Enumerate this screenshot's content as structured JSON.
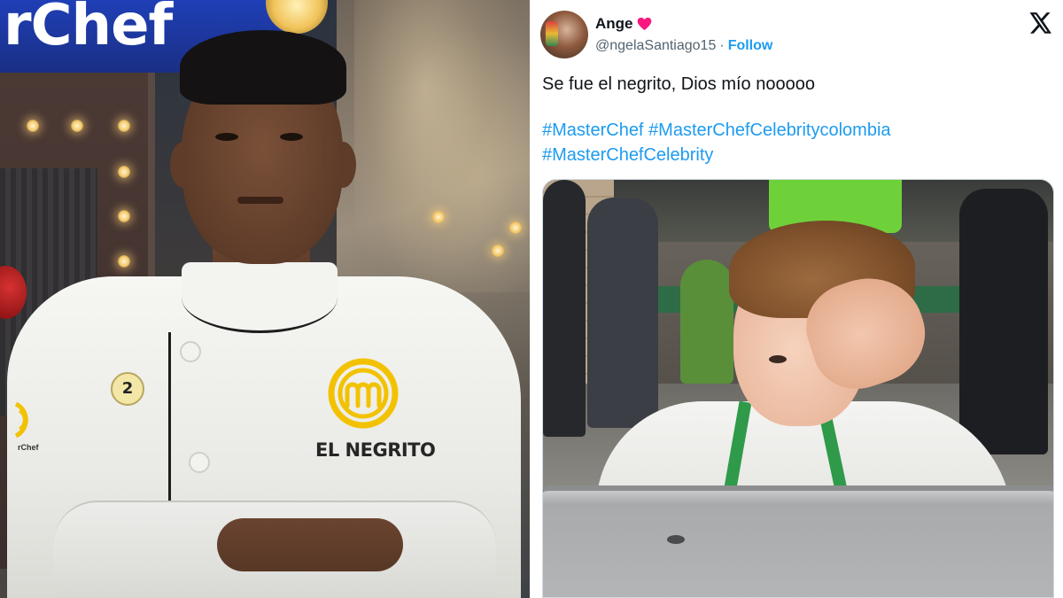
{
  "left_photo": {
    "sign_text": "rChef",
    "badge_number": "2",
    "name_tag": "EL NEGRITO",
    "sleeve_text": "rChef"
  },
  "tweet": {
    "display_name": "Ange",
    "handle": "@ngelaSantiago15",
    "separator": "·",
    "follow_label": "Follow",
    "text": "Se fue el negrito, Dios mío nooooo",
    "hashtags": [
      "#MasterChef",
      "#MasterChefCelebritycolombia",
      "#MasterChefCelebrity"
    ],
    "icons": {
      "heart": "heart-icon",
      "close": "x-logo-icon"
    },
    "colors": {
      "link": "#1d9bf0",
      "text": "#0f1419",
      "secondary": "#536471",
      "heart": "#f91880"
    }
  }
}
